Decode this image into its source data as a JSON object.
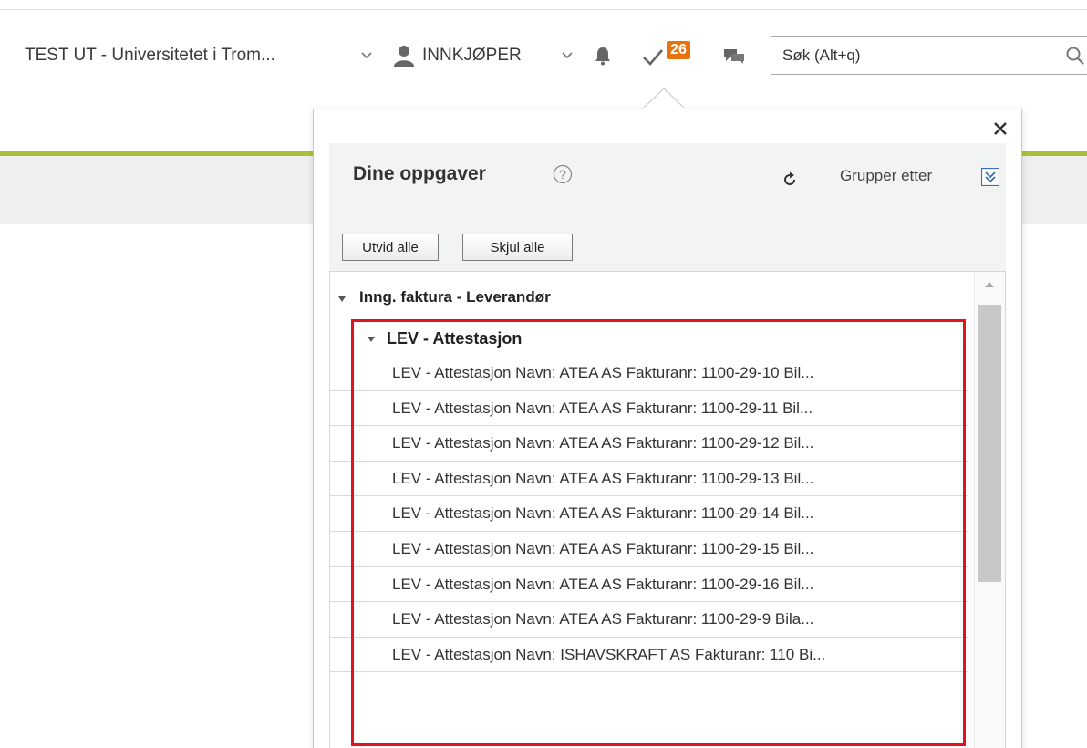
{
  "topbar": {
    "org_name": "TEST UT - Universitetet i Trom...",
    "role": "INNKJØPER",
    "task_count": "26",
    "search_placeholder": "Søk (Alt+q)"
  },
  "icons": {
    "org_dropdown": "chevron-down-icon",
    "user": "user-icon",
    "role_dropdown": "chevron-down-icon",
    "notifications": "bell-icon",
    "tasks": "check-icon",
    "messages": "chat-icon",
    "search": "search-icon",
    "close": "close-icon",
    "help": "help-icon",
    "refresh": "refresh-icon",
    "group_by": "double-chevron-down-icon"
  },
  "colors": {
    "accent_green": "#a7c23a",
    "badge_orange": "#e8720c",
    "highlight_red": "#e0141e"
  },
  "popup": {
    "title": "Dine oppgaver",
    "help_symbol": "?",
    "group_by_label": "Grupper etter",
    "expand_all": "Utvid alle",
    "collapse_all": "Skjul alle",
    "group": {
      "label": "Inng. faktura - Leverandør",
      "subgroup": {
        "label": "LEV - Attestasjon",
        "tasks": [
          "LEV - Attestasjon Navn: ATEA AS Fakturanr: 1100-29-10 Bil...",
          "LEV - Attestasjon Navn: ATEA AS Fakturanr: 1100-29-11 Bil...",
          "LEV - Attestasjon Navn: ATEA AS Fakturanr: 1100-29-12 Bil...",
          "LEV - Attestasjon Navn: ATEA AS Fakturanr: 1100-29-13 Bil...",
          "LEV - Attestasjon Navn: ATEA AS Fakturanr: 1100-29-14 Bil...",
          "LEV - Attestasjon Navn: ATEA AS Fakturanr: 1100-29-15 Bil...",
          "LEV - Attestasjon Navn: ATEA AS Fakturanr: 1100-29-16 Bil...",
          "LEV - Attestasjon Navn: ATEA AS Fakturanr: 1100-29-9 Bila...",
          "LEV - Attestasjon Navn: ISHAVSKRAFT AS Fakturanr: 110 Bi..."
        ]
      }
    }
  }
}
